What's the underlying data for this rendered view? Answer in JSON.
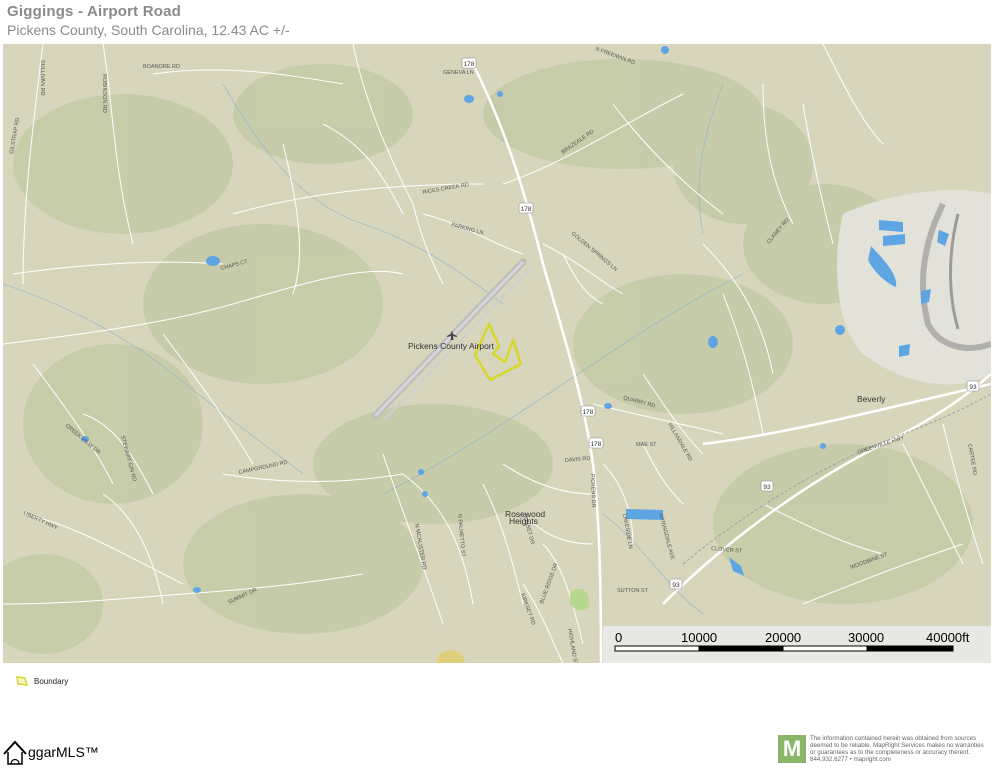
{
  "header": {
    "title": "Giggings - Airport Road",
    "subtitle": "Pickens County, South Carolina, 12.43 AC +/-"
  },
  "map": {
    "airport_label": "Pickens County Airport",
    "neighborhood_label_1": "Rosewood",
    "neighborhood_label_2": "Heights",
    "town_label": "Beverly",
    "highway_shields": [
      "178",
      "178",
      "178",
      "178",
      "93",
      "93",
      "93"
    ],
    "road_labels": [
      "BOANORE RD",
      "SULLIVAN RD",
      "GILSTRAP RD",
      "ROBINSON RD",
      "GENEVA LN",
      "N FREEMAN RD",
      "BRAZEALE RD",
      "RICES CREEK RD",
      "PARKING LN",
      "CHAPS CT",
      "GOLDEN SPRINGS LN",
      "CLANEY RD",
      "QUARRY RD",
      "CAMPGROUND RD",
      "CREEK VIEW DR",
      "STEWART GIN RD",
      "LIBERTY HWY",
      "N MCALISTER RD",
      "N PALMETTO ST",
      "SUNSET DR",
      "DAVIS RD",
      "PICKENS DR",
      "MAE ST",
      "LAKESIDE LN",
      "SPRINGDALE AVE",
      "GREENVILLE HWY",
      "CLOVER ST",
      "WOODBINE ST",
      "CARTEE RD",
      "HILLANDALE RD",
      "SUMMIT DR",
      "SUTTON ST",
      "BLUE RIDGE DR",
      "HIGHLAND ST",
      "KIRKSEY RD"
    ],
    "colors": {
      "land": "#d7d6bd",
      "forest": "#c3c9a5",
      "road": "#ffffff",
      "water": "#5ea5e4",
      "boundary": "#d7d72a",
      "runway": "#c7c7c7"
    }
  },
  "scale": {
    "ticks": [
      "0",
      "10000",
      "20000",
      "30000",
      "40000ft"
    ]
  },
  "legend": {
    "label": "Boundary",
    "color": "#d7d72a"
  },
  "brand": {
    "name": "ggarMLS™"
  },
  "disclaimer": {
    "text": "The information contained herein was obtained from sources deemed to be reliable. MapRight Services makes no warranties or guarantees as to the completeness or accuracy thereof. 844.932.6277 • mapright.com",
    "logo_letter": "M"
  }
}
